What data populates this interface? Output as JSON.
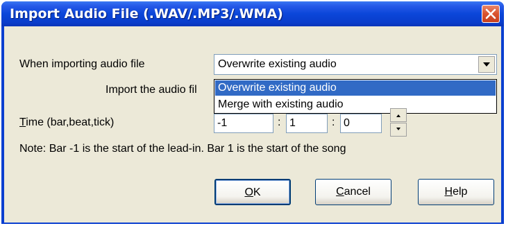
{
  "window": {
    "title": "Import Audio File (.WAV/.MP3/.WMA)"
  },
  "form": {
    "when_importing_label": "When importing audio file",
    "combo_value": "Overwrite existing audio",
    "dropdown_options": [
      "Overwrite existing audio",
      "Merge with existing audio"
    ],
    "selected_option_index": 0,
    "import_label_partial": "Import the audio fil",
    "time_label_first": "T",
    "time_label_rest": "ime (bar,beat,tick)",
    "time_bar": "-1",
    "time_beat": "1",
    "time_tick": "0",
    "colon": ":",
    "note": "Note: Bar -1 is the start of the lead-in. Bar 1 is the start of the song"
  },
  "buttons": {
    "ok_underline": "O",
    "ok_rest": "K",
    "cancel_underline": "C",
    "cancel_rest": "ancel",
    "help_underline": "H",
    "help_rest": "elp"
  },
  "icons": {
    "close": "close-x-icon",
    "combo_arrow": "dropdown-arrow-icon",
    "spin_up": "spin-up-icon",
    "spin_down": "spin-down-icon"
  }
}
